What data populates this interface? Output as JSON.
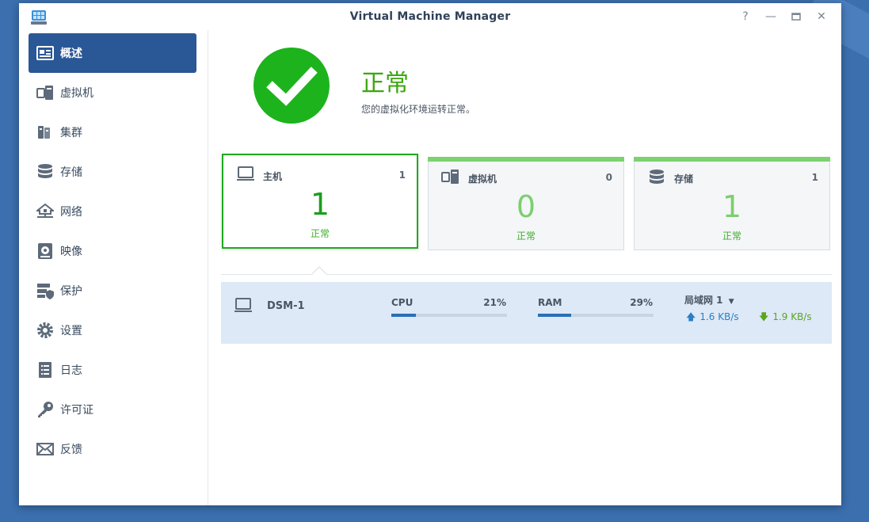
{
  "window": {
    "title": "Virtual Machine Manager",
    "controls": [
      "help-icon",
      "minimize-icon",
      "maximize-icon",
      "close-icon"
    ]
  },
  "sidebar": {
    "items": [
      {
        "label": "概述",
        "icon": "overview-icon",
        "active": true
      },
      {
        "label": "虚拟机",
        "icon": "virtual-machine-icon",
        "active": false
      },
      {
        "label": "集群",
        "icon": "cluster-icon",
        "active": false
      },
      {
        "label": "存储",
        "icon": "storage-icon",
        "active": false
      },
      {
        "label": "网络",
        "icon": "network-icon",
        "active": false
      },
      {
        "label": "映像",
        "icon": "image-icon",
        "active": false
      },
      {
        "label": "保护",
        "icon": "protection-icon",
        "active": false
      },
      {
        "label": "设置",
        "icon": "settings-icon",
        "active": false
      },
      {
        "label": "日志",
        "icon": "log-icon",
        "active": false
      },
      {
        "label": "许可证",
        "icon": "license-key-icon",
        "active": false
      },
      {
        "label": "反馈",
        "icon": "feedback-icon",
        "active": false
      }
    ]
  },
  "status": {
    "title": "正常",
    "description": "您的虚拟化环境运转正常。",
    "icon": "check-icon"
  },
  "cards": [
    {
      "title": "主机",
      "count": "1",
      "value": "1",
      "state": "正常",
      "icon": "host-icon"
    },
    {
      "title": "虚拟机",
      "count": "0",
      "value": "0",
      "state": "正常",
      "icon": "virtual-machine-icon"
    },
    {
      "title": "存储",
      "count": "1",
      "value": "1",
      "state": "正常",
      "icon": "storage-icon"
    }
  ],
  "host": {
    "name": "DSM-1",
    "cpu_label": "CPU",
    "cpu_value": "21%",
    "cpu_fraction": 0.21,
    "ram_label": "RAM",
    "ram_value": "29%",
    "ram_fraction": 0.29,
    "network_label": "局域网 1",
    "upload": "1.6 KB/s",
    "download": "1.9 KB/s"
  },
  "colors": {
    "accent": "#2a5796",
    "ok_green": "#1db31d",
    "card_bar": "#7bd26e",
    "row_bg": "#dde9f7",
    "upload": "#2a7fc4",
    "download": "#5ba51e"
  }
}
